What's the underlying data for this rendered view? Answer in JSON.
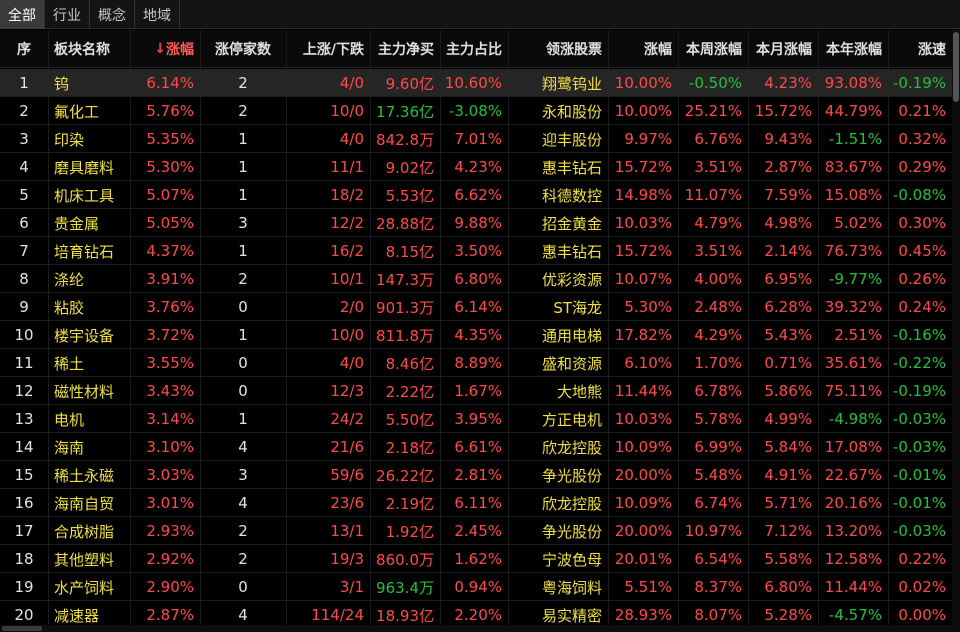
{
  "tabs": [
    {
      "label": "全部",
      "active": true
    },
    {
      "label": "行业",
      "active": false
    },
    {
      "label": "概念",
      "active": false
    },
    {
      "label": "地域",
      "active": false
    }
  ],
  "columns": [
    {
      "key": "seq",
      "label": "序"
    },
    {
      "key": "name",
      "label": "板块名称"
    },
    {
      "key": "chg",
      "label": "涨幅",
      "sort_indicator": "↓"
    },
    {
      "key": "limit_up",
      "label": "涨停家数"
    },
    {
      "key": "up_down",
      "label": "上涨/下跌"
    },
    {
      "key": "net_buy",
      "label": "主力净买"
    },
    {
      "key": "main_pct",
      "label": "主力占比"
    },
    {
      "key": "leader",
      "label": "领涨股票"
    },
    {
      "key": "leader_chg",
      "label": "涨幅"
    },
    {
      "key": "week_chg",
      "label": "本周涨幅"
    },
    {
      "key": "month_chg",
      "label": "本月涨幅"
    },
    {
      "key": "year_chg",
      "label": "本年涨幅"
    },
    {
      "key": "speed",
      "label": "涨速"
    }
  ],
  "colors": {
    "up": "#ff4a4a",
    "down": "#21c13a",
    "name": "#f0e040",
    "neutral": "#e4e4e4"
  },
  "rows": [
    {
      "seq": "1",
      "name": "钨",
      "chg": "6.14%",
      "limit_up": "2",
      "up_down": "4/0",
      "net_buy": "9.60亿",
      "main_pct": "10.60%",
      "leader": "翔鹭钨业",
      "leader_chg": "10.00%",
      "week_chg": "-0.50%",
      "month_chg": "4.23%",
      "year_chg": "93.08%",
      "speed": "-0.19%"
    },
    {
      "seq": "2",
      "name": "氟化工",
      "chg": "5.76%",
      "limit_up": "2",
      "up_down": "10/0",
      "net_buy": "17.36亿",
      "main_pct": "-3.08%",
      "leader": "永和股份",
      "leader_chg": "10.00%",
      "week_chg": "25.21%",
      "month_chg": "15.72%",
      "year_chg": "44.79%",
      "speed": "0.21%"
    },
    {
      "seq": "3",
      "name": "印染",
      "chg": "5.35%",
      "limit_up": "1",
      "up_down": "4/0",
      "net_buy": "842.8万",
      "main_pct": "7.01%",
      "leader": "迎丰股份",
      "leader_chg": "9.97%",
      "week_chg": "6.76%",
      "month_chg": "9.43%",
      "year_chg": "-1.51%",
      "speed": "0.32%"
    },
    {
      "seq": "4",
      "name": "磨具磨料",
      "chg": "5.30%",
      "limit_up": "1",
      "up_down": "11/1",
      "net_buy": "9.02亿",
      "main_pct": "4.23%",
      "leader": "惠丰钻石",
      "leader_chg": "15.72%",
      "week_chg": "3.51%",
      "month_chg": "2.87%",
      "year_chg": "83.67%",
      "speed": "0.29%"
    },
    {
      "seq": "5",
      "name": "机床工具",
      "chg": "5.07%",
      "limit_up": "1",
      "up_down": "18/2",
      "net_buy": "5.53亿",
      "main_pct": "6.62%",
      "leader": "科德数控",
      "leader_chg": "14.98%",
      "week_chg": "11.07%",
      "month_chg": "7.59%",
      "year_chg": "15.08%",
      "speed": "-0.08%"
    },
    {
      "seq": "6",
      "name": "贵金属",
      "chg": "5.05%",
      "limit_up": "3",
      "up_down": "12/2",
      "net_buy": "28.88亿",
      "main_pct": "9.88%",
      "leader": "招金黄金",
      "leader_chg": "10.03%",
      "week_chg": "4.79%",
      "month_chg": "4.98%",
      "year_chg": "5.02%",
      "speed": "0.30%"
    },
    {
      "seq": "7",
      "name": "培育钻石",
      "chg": "4.37%",
      "limit_up": "1",
      "up_down": "16/2",
      "net_buy": "8.15亿",
      "main_pct": "3.50%",
      "leader": "惠丰钻石",
      "leader_chg": "15.72%",
      "week_chg": "3.51%",
      "month_chg": "2.14%",
      "year_chg": "76.73%",
      "speed": "0.45%"
    },
    {
      "seq": "8",
      "name": "涤纶",
      "chg": "3.91%",
      "limit_up": "2",
      "up_down": "10/1",
      "net_buy": "147.3万",
      "main_pct": "6.80%",
      "leader": "优彩资源",
      "leader_chg": "10.07%",
      "week_chg": "4.00%",
      "month_chg": "6.95%",
      "year_chg": "-9.77%",
      "speed": "0.26%"
    },
    {
      "seq": "9",
      "name": "粘胶",
      "chg": "3.76%",
      "limit_up": "0",
      "up_down": "2/0",
      "net_buy": "901.3万",
      "main_pct": "6.14%",
      "leader": "ST海龙",
      "leader_chg": "5.30%",
      "week_chg": "2.48%",
      "month_chg": "6.28%",
      "year_chg": "39.32%",
      "speed": "0.24%"
    },
    {
      "seq": "10",
      "name": "楼宇设备",
      "chg": "3.72%",
      "limit_up": "1",
      "up_down": "10/0",
      "net_buy": "811.8万",
      "main_pct": "4.35%",
      "leader": "通用电梯",
      "leader_chg": "17.82%",
      "week_chg": "4.29%",
      "month_chg": "5.43%",
      "year_chg": "2.51%",
      "speed": "-0.16%"
    },
    {
      "seq": "11",
      "name": "稀土",
      "chg": "3.55%",
      "limit_up": "0",
      "up_down": "4/0",
      "net_buy": "8.46亿",
      "main_pct": "8.89%",
      "leader": "盛和资源",
      "leader_chg": "6.10%",
      "week_chg": "1.70%",
      "month_chg": "0.71%",
      "year_chg": "35.61%",
      "speed": "-0.22%"
    },
    {
      "seq": "12",
      "name": "磁性材料",
      "chg": "3.43%",
      "limit_up": "0",
      "up_down": "12/3",
      "net_buy": "2.22亿",
      "main_pct": "1.67%",
      "leader": "大地熊",
      "leader_chg": "11.44%",
      "week_chg": "6.78%",
      "month_chg": "5.86%",
      "year_chg": "75.11%",
      "speed": "-0.19%"
    },
    {
      "seq": "13",
      "name": "电机",
      "chg": "3.14%",
      "limit_up": "1",
      "up_down": "24/2",
      "net_buy": "5.50亿",
      "main_pct": "3.95%",
      "leader": "方正电机",
      "leader_chg": "10.03%",
      "week_chg": "5.78%",
      "month_chg": "4.99%",
      "year_chg": "-4.98%",
      "speed": "-0.03%"
    },
    {
      "seq": "14",
      "name": "海南",
      "chg": "3.10%",
      "limit_up": "4",
      "up_down": "21/6",
      "net_buy": "2.18亿",
      "main_pct": "6.61%",
      "leader": "欣龙控股",
      "leader_chg": "10.09%",
      "week_chg": "6.99%",
      "month_chg": "5.84%",
      "year_chg": "17.08%",
      "speed": "-0.03%"
    },
    {
      "seq": "15",
      "name": "稀土永磁",
      "chg": "3.03%",
      "limit_up": "3",
      "up_down": "59/6",
      "net_buy": "26.22亿",
      "main_pct": "2.81%",
      "leader": "争光股份",
      "leader_chg": "20.00%",
      "week_chg": "5.48%",
      "month_chg": "4.91%",
      "year_chg": "22.67%",
      "speed": "-0.01%"
    },
    {
      "seq": "16",
      "name": "海南自贸",
      "chg": "3.01%",
      "limit_up": "4",
      "up_down": "23/6",
      "net_buy": "2.19亿",
      "main_pct": "6.11%",
      "leader": "欣龙控股",
      "leader_chg": "10.09%",
      "week_chg": "6.74%",
      "month_chg": "5.71%",
      "year_chg": "20.16%",
      "speed": "-0.01%"
    },
    {
      "seq": "17",
      "name": "合成树脂",
      "chg": "2.93%",
      "limit_up": "2",
      "up_down": "13/1",
      "net_buy": "1.92亿",
      "main_pct": "2.45%",
      "leader": "争光股份",
      "leader_chg": "20.00%",
      "week_chg": "10.97%",
      "month_chg": "7.12%",
      "year_chg": "13.20%",
      "speed": "-0.03%"
    },
    {
      "seq": "18",
      "name": "其他塑料",
      "chg": "2.92%",
      "limit_up": "2",
      "up_down": "19/3",
      "net_buy": "860.0万",
      "main_pct": "1.62%",
      "leader": "宁波色母",
      "leader_chg": "20.01%",
      "week_chg": "6.54%",
      "month_chg": "5.58%",
      "year_chg": "12.58%",
      "speed": "0.22%"
    },
    {
      "seq": "19",
      "name": "水产饲料",
      "chg": "2.90%",
      "limit_up": "0",
      "up_down": "3/1",
      "net_buy": "963.4万",
      "main_pct": "0.94%",
      "leader": "粤海饲料",
      "leader_chg": "5.51%",
      "week_chg": "8.37%",
      "month_chg": "6.80%",
      "year_chg": "11.44%",
      "speed": "0.02%"
    },
    {
      "seq": "20",
      "name": "减速器",
      "chg": "2.87%",
      "limit_up": "4",
      "up_down": "114/24",
      "net_buy": "18.93亿",
      "main_pct": "2.20%",
      "leader": "易实精密",
      "leader_chg": "28.93%",
      "week_chg": "8.07%",
      "month_chg": "5.28%",
      "year_chg": "-4.57%",
      "speed": "0.00%"
    }
  ]
}
